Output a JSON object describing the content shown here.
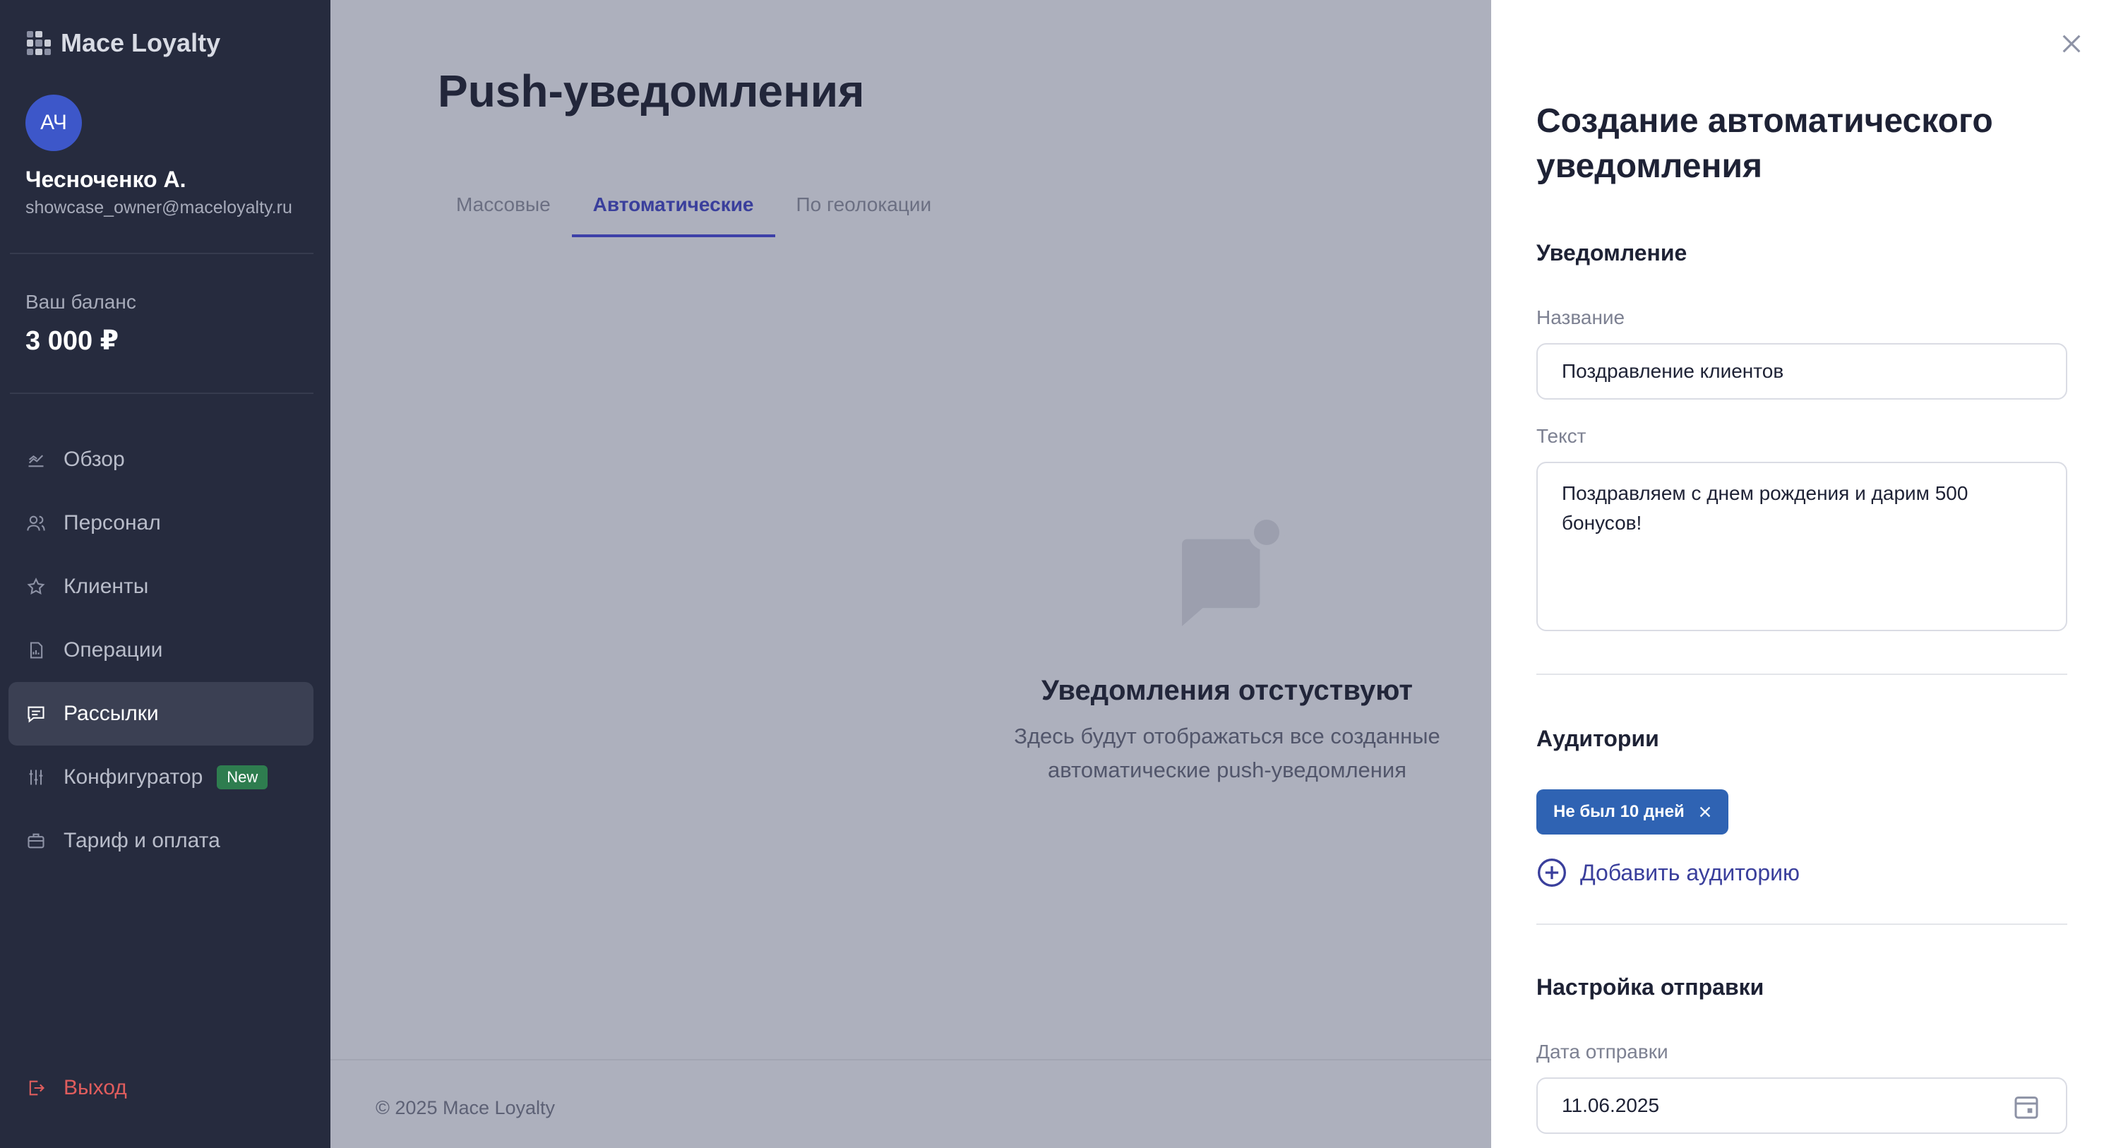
{
  "app": {
    "name": "Mace Loyalty"
  },
  "user": {
    "initials": "АЧ",
    "name": "Чесноченко А.",
    "email": "showcase_owner@maceloyalty.ru"
  },
  "balance": {
    "label": "Ваш баланс",
    "value": "3 000 ₽"
  },
  "sidebar": {
    "items": [
      {
        "label": "Обзор",
        "icon": "chart-icon"
      },
      {
        "label": "Персонал",
        "icon": "users-icon"
      },
      {
        "label": "Клиенты",
        "icon": "star-icon"
      },
      {
        "label": "Операции",
        "icon": "document-icon"
      },
      {
        "label": "Рассылки",
        "icon": "message-icon",
        "active": true
      },
      {
        "label": "Конфигуратор",
        "icon": "sliders-icon",
        "badge": "New"
      },
      {
        "label": "Тариф и оплата",
        "icon": "briefcase-icon"
      }
    ],
    "logout": "Выход"
  },
  "main": {
    "title": "Push-уведомления",
    "tabs": [
      {
        "label": "Массовые"
      },
      {
        "label": "Автоматические",
        "active": true
      },
      {
        "label": "По геолокации"
      }
    ],
    "empty": {
      "title": "Уведомления отстуствуют",
      "line1": "Здесь будут отображаться все созданные",
      "line2": "автоматические push-уведомления"
    },
    "footer": "© 2025 Mace Loyalty"
  },
  "panel": {
    "title": "Создание автоматического уведомления",
    "notification_section": "Уведомление",
    "name_label": "Название",
    "name_value": "Поздравление клиентов",
    "text_label": "Текст",
    "text_value": "Поздравляем с днем рождения и дарим 500 бонусов!",
    "audiences_section": "Аудитории",
    "audience_chip": "Не был 10 дней",
    "add_audience": "Добавить аудиторию",
    "sending_section": "Настройка отправки",
    "date_label": "Дата отправки",
    "date_value": "11.06.2025"
  },
  "colors": {
    "sidebar": "#262b3e",
    "accent": "#3d40a8",
    "chip": "#2f63b3",
    "logout": "#e05d5d",
    "badge": "#2e7d4f"
  }
}
